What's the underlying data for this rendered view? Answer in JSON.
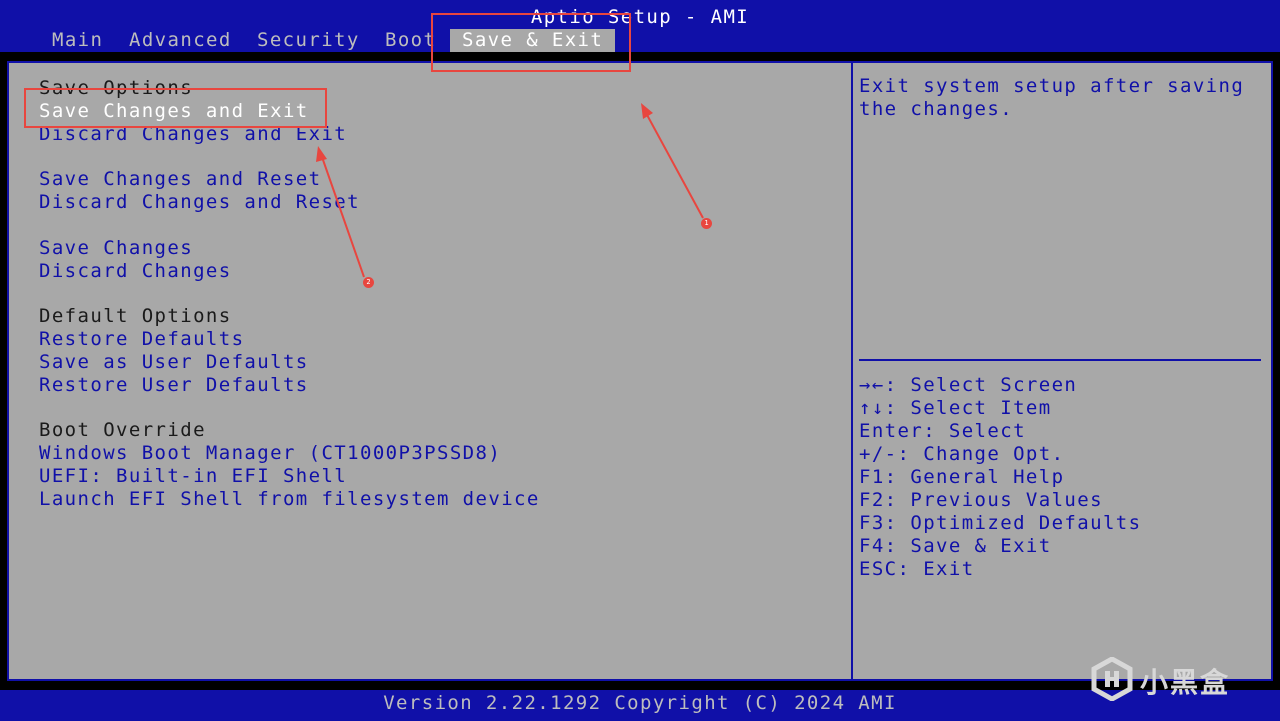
{
  "header": {
    "title": "Aptio Setup - AMI",
    "tabs": [
      "Main",
      "Advanced",
      "Security",
      "Boot",
      "Save & Exit"
    ],
    "active_tab": "Save & Exit"
  },
  "menu": {
    "save_options_heading": "Save Options",
    "save_changes_and_exit": "Save Changes and Exit",
    "discard_changes_and_exit": "Discard Changes and Exit",
    "save_changes_and_reset": "Save Changes and Reset",
    "discard_changes_and_reset": "Discard Changes and Reset",
    "save_changes": "Save Changes",
    "discard_changes": "Discard Changes",
    "default_options_heading": "Default Options",
    "restore_defaults": "Restore Defaults",
    "save_as_user_defaults": "Save as User Defaults",
    "restore_user_defaults": "Restore User Defaults",
    "boot_override_heading": "Boot Override",
    "boot_windows": "Windows Boot Manager (CT1000P3PSSD8)",
    "boot_uefi_shell": "UEFI: Built-in EFI Shell",
    "boot_launch_efi": "Launch EFI Shell from filesystem device",
    "selected_item": "Save Changes and Exit"
  },
  "help": {
    "description": "Exit system setup after saving\nthe changes.",
    "keys": [
      "→←: Select Screen",
      "↑↓: Select Item",
      "Enter: Select",
      "+/-: Change Opt.",
      "F1: General Help",
      "F2: Previous Values",
      "F3: Optimized Defaults",
      "F4: Save & Exit",
      "ESC: Exit"
    ]
  },
  "footer": {
    "version": "Version 2.22.1292 Copyright (C) 2024 AMI"
  },
  "annotations": {
    "badge_1": "1",
    "badge_2": "2",
    "color": "#e8463f"
  },
  "watermark": {
    "text": "小黑盒"
  },
  "colors": {
    "bios_blue": "#1010a8",
    "panel_gray": "#a8a8a8",
    "highlight_white": "#ffffff"
  }
}
